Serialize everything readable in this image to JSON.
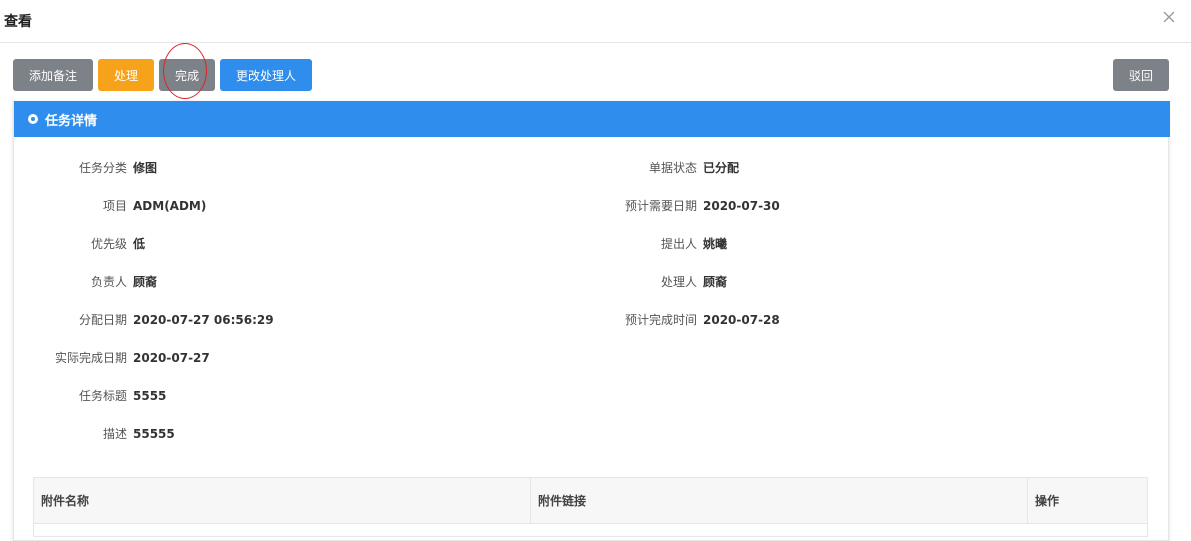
{
  "dialog": {
    "title": "查看"
  },
  "toolbar": {
    "add_note": "添加备注",
    "process": "处理",
    "complete": "完成",
    "change_handler": "更改处理人",
    "reject": "驳回"
  },
  "panel": {
    "title": "任务详情"
  },
  "details": {
    "left": [
      {
        "label": "任务分类",
        "value": "修图"
      },
      {
        "label": "项目",
        "value": "ADM(ADM)"
      },
      {
        "label": "优先级",
        "value": "低"
      },
      {
        "label": "负责人",
        "value": "顾裔"
      },
      {
        "label": "分配日期",
        "value": "2020-07-27 06:56:29"
      },
      {
        "label": "实际完成日期",
        "value": "2020-07-27"
      },
      {
        "label": "任务标题",
        "value": "5555"
      },
      {
        "label": "描述",
        "value": "55555"
      }
    ],
    "right": [
      {
        "label": "单据状态",
        "value": "已分配"
      },
      {
        "label": "预计需要日期",
        "value": "2020-07-30"
      },
      {
        "label": "提出人",
        "value": "姚曦"
      },
      {
        "label": "处理人",
        "value": "顾裔"
      },
      {
        "label": "预计完成时间",
        "value": "2020-07-28"
      }
    ]
  },
  "attachments": {
    "columns": [
      "附件名称",
      "附件链接",
      "操作"
    ]
  },
  "colors": {
    "primary": "#2e8ded",
    "warning": "#f7a21b",
    "neutral": "#7d8188",
    "annotation": "#d9262c"
  }
}
